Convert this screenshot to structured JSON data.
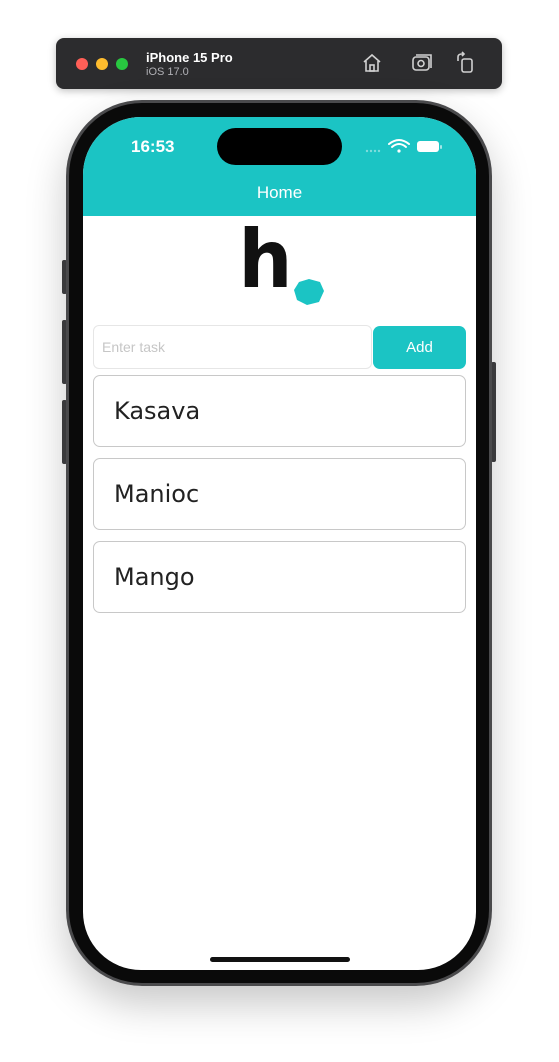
{
  "simulator": {
    "device_name": "iPhone 15 Pro",
    "os_version": "iOS 17.0",
    "icons": [
      "home-icon",
      "screenshot-icon",
      "rotate-icon"
    ]
  },
  "status_bar": {
    "time": "16:53",
    "icons": [
      "signal-dots-icon",
      "wifi-icon",
      "battery-icon"
    ]
  },
  "nav": {
    "title": "Home"
  },
  "logo": {
    "text": "h",
    "accent_color": "#1bc4c4"
  },
  "task_form": {
    "input_value": "",
    "input_placeholder": "Enter task",
    "add_label": "Add"
  },
  "tasks": [
    {
      "label": "Kasava"
    },
    {
      "label": "Manioc"
    },
    {
      "label": "Mango"
    }
  ],
  "colors": {
    "accent": "#1bc4c4",
    "header_text": "#ffffff",
    "card_border": "#c8c8c8"
  }
}
